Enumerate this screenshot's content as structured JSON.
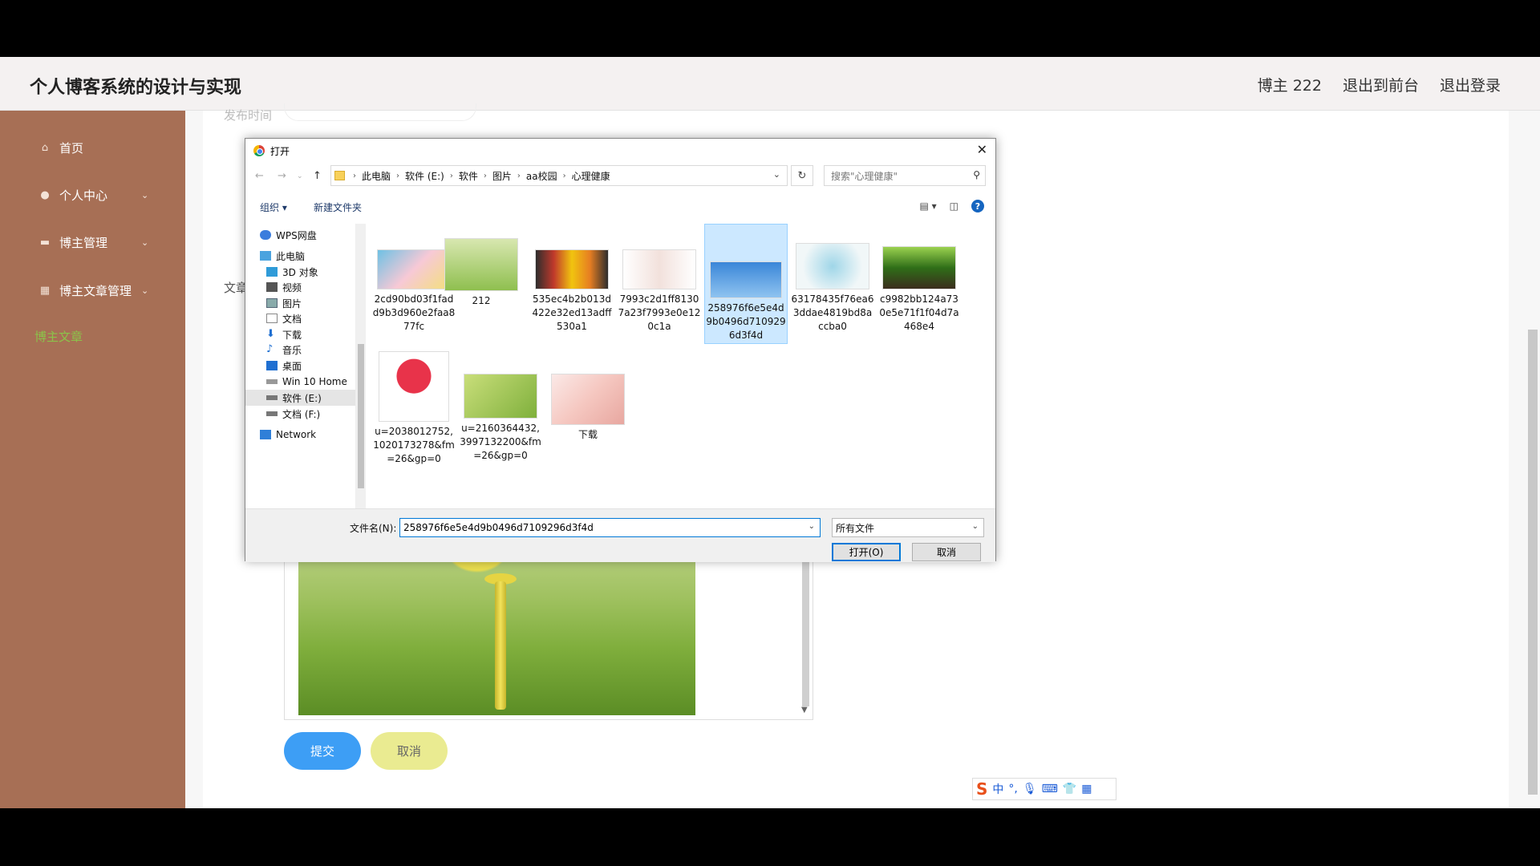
{
  "header": {
    "site_title": "个人博客系统的设计与实现",
    "user": "博主 222",
    "front_link": "退出到前台",
    "logout_link": "退出登录"
  },
  "sidebar": {
    "items": [
      {
        "label": "首页",
        "icon": "home-icon"
      },
      {
        "label": "个人中心",
        "icon": "user-icon"
      },
      {
        "label": "博主管理",
        "icon": "comment-icon"
      },
      {
        "label": "博主文章管理",
        "icon": "grid-icon"
      }
    ],
    "active_sub": "博主文章",
    "accent": "#a76f55",
    "active_color": "#8bc34a"
  },
  "form": {
    "faded_label": "发布时间",
    "article_label": "文章",
    "submit_label": "提交",
    "cancel_label": "取消"
  },
  "dialog": {
    "title": "打开",
    "breadcrumbs": [
      "此电脑",
      "软件 (E:)",
      "软件",
      "图片",
      "aa校园",
      "心理健康"
    ],
    "search_placeholder": "搜索\"心理健康\"",
    "toolbar": {
      "organize": "组织 ▾",
      "new_folder": "新建文件夹",
      "help": "?"
    },
    "tree": [
      {
        "label": "WPS网盘",
        "icon": "cloud-icon",
        "indent": 0
      },
      {
        "label": "此电脑",
        "icon": "pc-icon",
        "indent": 0
      },
      {
        "label": "3D 对象",
        "icon": "cube-icon",
        "indent": 1
      },
      {
        "label": "视频",
        "icon": "video-icon",
        "indent": 1
      },
      {
        "label": "图片",
        "icon": "picture-icon",
        "indent": 1
      },
      {
        "label": "文档",
        "icon": "document-icon",
        "indent": 1
      },
      {
        "label": "下载",
        "icon": "download-icon",
        "indent": 1
      },
      {
        "label": "音乐",
        "icon": "music-icon",
        "indent": 1
      },
      {
        "label": "桌面",
        "icon": "desktop-icon",
        "indent": 1
      },
      {
        "label": "Win 10 Home",
        "icon": "drive-icon",
        "indent": 1
      },
      {
        "label": "软件 (E:)",
        "icon": "drive-icon",
        "indent": 1
      },
      {
        "label": "文档 (F:)",
        "icon": "drive-icon",
        "indent": 1
      },
      {
        "label": "Network",
        "icon": "network-icon",
        "indent": 0
      }
    ],
    "files": [
      {
        "name": "2cd90bd03f1fadd9b3d960e2faa877fc"
      },
      {
        "name": "212"
      },
      {
        "name": "535ec4b2b013d422e32ed13adff530a1"
      },
      {
        "name": "7993c2d1ff81307a23f7993e0e120c1a"
      },
      {
        "name": "258976f6e5e4d9b0496d7109296d3f4d"
      },
      {
        "name": "63178435f76ea63ddae4819bd8accba0"
      },
      {
        "name": "c9982bb124a730e5e71f1f04d7a468e4"
      },
      {
        "name": "u=2038012752,1020173278&fm=26&gp=0"
      },
      {
        "name": "u=2160364432,3997132200&fm=26&gp=0"
      },
      {
        "name": "下载"
      }
    ],
    "selected_file": "258976f6e5e4d9b0496d7109296d3f4d",
    "filename_label": "文件名(N):",
    "filename_value": "258976f6e5e4d9b0496d7109296d3f4d",
    "filetype": "所有文件",
    "open_label": "打开(O)",
    "cancel_label": "取消"
  },
  "ime": {
    "mode": "中"
  }
}
